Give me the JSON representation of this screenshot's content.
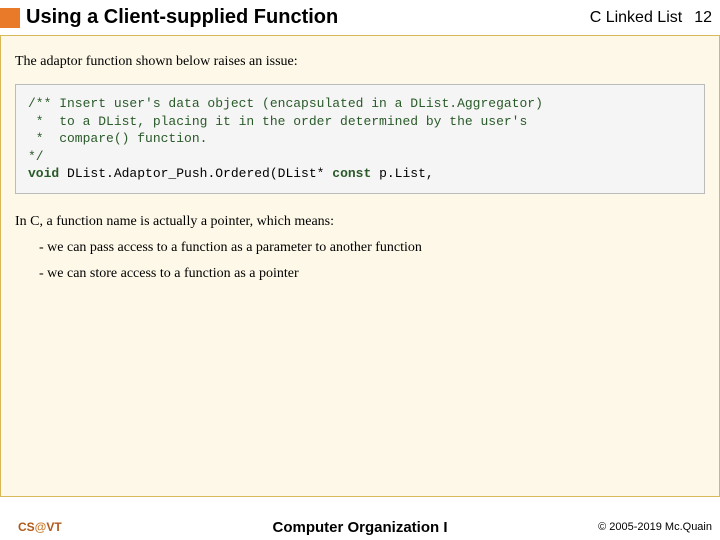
{
  "header": {
    "title": "Using a Client-supplied Function",
    "subtitle": "C Linked List",
    "page_number": "12"
  },
  "intro": "The adaptor function shown below raises an issue:",
  "code": {
    "c1": "/** Insert user's data object (encapsulated in a DList.Aggregator)",
    "c2": " *  to a DList, placing it in the order determined by the user's",
    "c3": " *  compare() function.",
    "c4": "*/",
    "kw_void": "void",
    "fn": " DList.Adaptor_Push.Ordered(DList* ",
    "kw_const": "const",
    "tail": " p.List,"
  },
  "body1": "In C, a function name is actually a pointer, which means:",
  "bullet1": "-  we can pass access to a function as a parameter to another function",
  "bullet2": "-  we can store access to a function as a pointer",
  "footer": {
    "left_cs": "CS",
    "left_at": "@",
    "left_vt": "VT",
    "center": "Computer Organization I",
    "right": "© 2005-2019 Mc.Quain"
  }
}
